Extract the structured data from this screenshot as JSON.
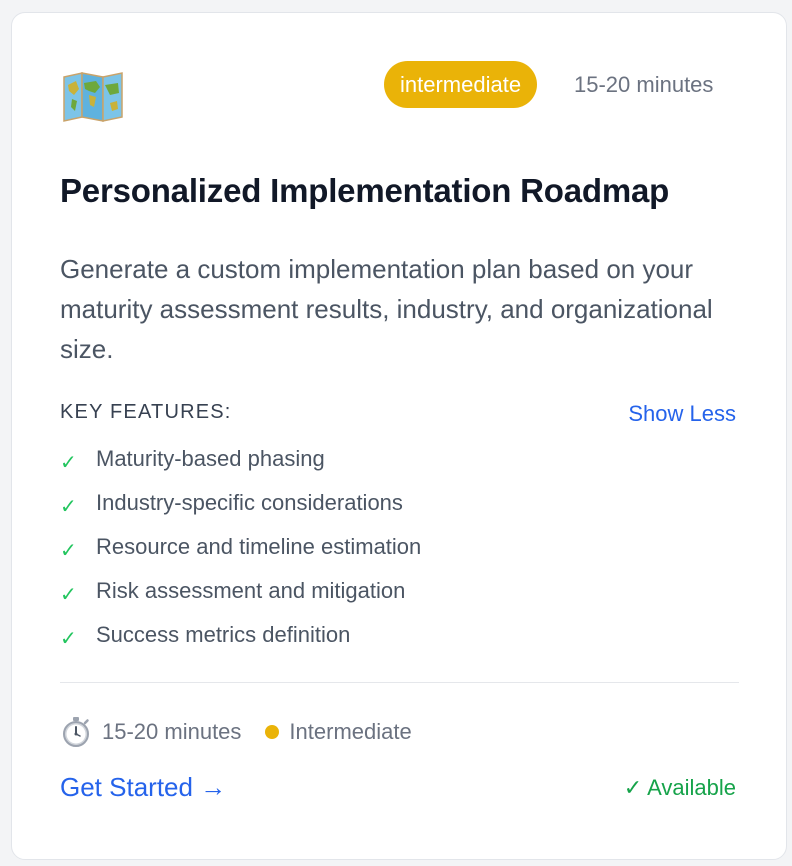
{
  "card": {
    "icon": "folded-world-map-icon",
    "level_badge": "intermediate",
    "duration": "15-20 minutes",
    "title": "Personalized Implementation Roadmap",
    "description": "Generate a custom implementation plan based on your maturity assessment results, industry, and organizational size.",
    "features_heading": "KEY FEATURES:",
    "toggle_label": "Show Less",
    "features": [
      "Maturity-based phasing",
      "Industry-specific considerations",
      "Resource and timeline estimation",
      "Risk assessment and mitigation",
      "Success metrics definition"
    ],
    "check_glyph": "✓",
    "footer": {
      "duration_icon": "stopwatch-icon",
      "duration": "15-20 minutes",
      "level": "Intermediate",
      "cta_label": "Get Started →",
      "status": "✓ Available"
    }
  },
  "colors": {
    "accent_blue": "#2563eb",
    "badge_yellow": "#eab308",
    "check_green": "#22c55e",
    "status_green": "#16a34a",
    "title_text": "#111827",
    "body_text": "#4b5563",
    "muted_text": "#6b7280"
  }
}
